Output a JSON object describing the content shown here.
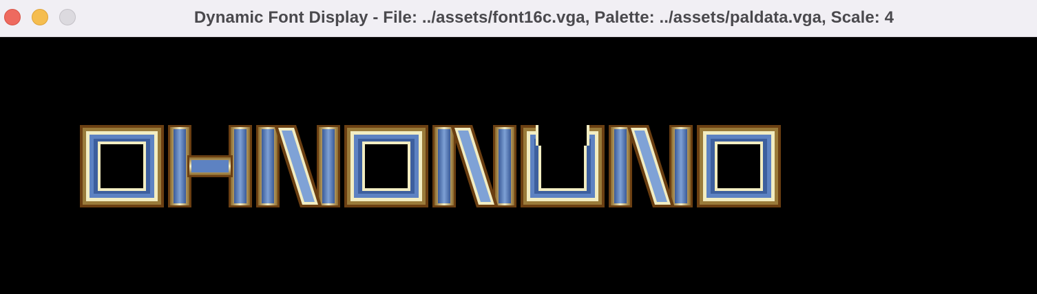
{
  "window": {
    "title": "Dynamic Font Display - File: ../assets/font16c.vga, Palette: ../assets/paldata.vga, Scale: 4"
  },
  "window_controls": {
    "close": "close-icon",
    "minimize": "minimize-icon",
    "zoom": "zoom-icon"
  },
  "display": {
    "text": "OHNONUNO",
    "background": "#000000",
    "palette": {
      "outline": "#6b3f12",
      "gold_dark": "#9a7b3a",
      "gold_light": "#f2edc2",
      "blue_dark": "#3d5f9e",
      "blue": "#5d82c2",
      "blue_light": "#7fa2d6"
    }
  }
}
